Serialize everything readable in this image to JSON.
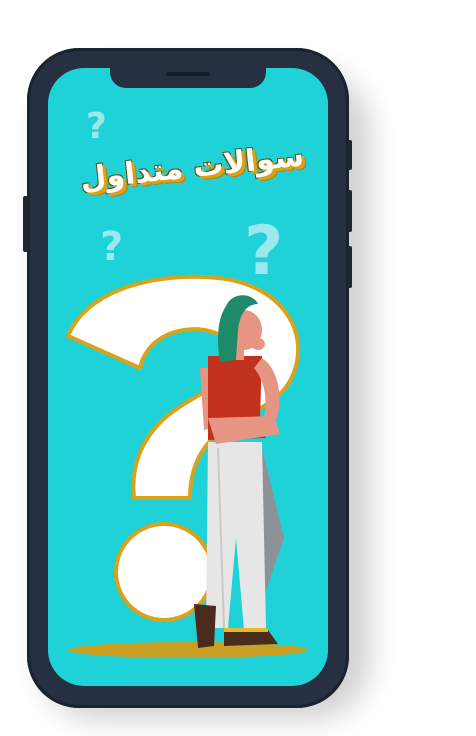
{
  "screen": {
    "title": "سوالات متداول"
  },
  "colors": {
    "screen_bg": "#1ed2d8",
    "frame": "#263040",
    "title_text": "#ffffff",
    "title_shadow": "#d9a21a",
    "question_mark_light": "#9de8ee",
    "big_question_mark": "#ffffff",
    "gold_outline": "#d9a21a",
    "shirt": "#c0311e",
    "pants": "#e6e6e6",
    "hair": "#1f8a6a",
    "skin": "#e69583"
  },
  "icons": [
    "question-mark-icon",
    "big-question-mark-icon"
  ]
}
